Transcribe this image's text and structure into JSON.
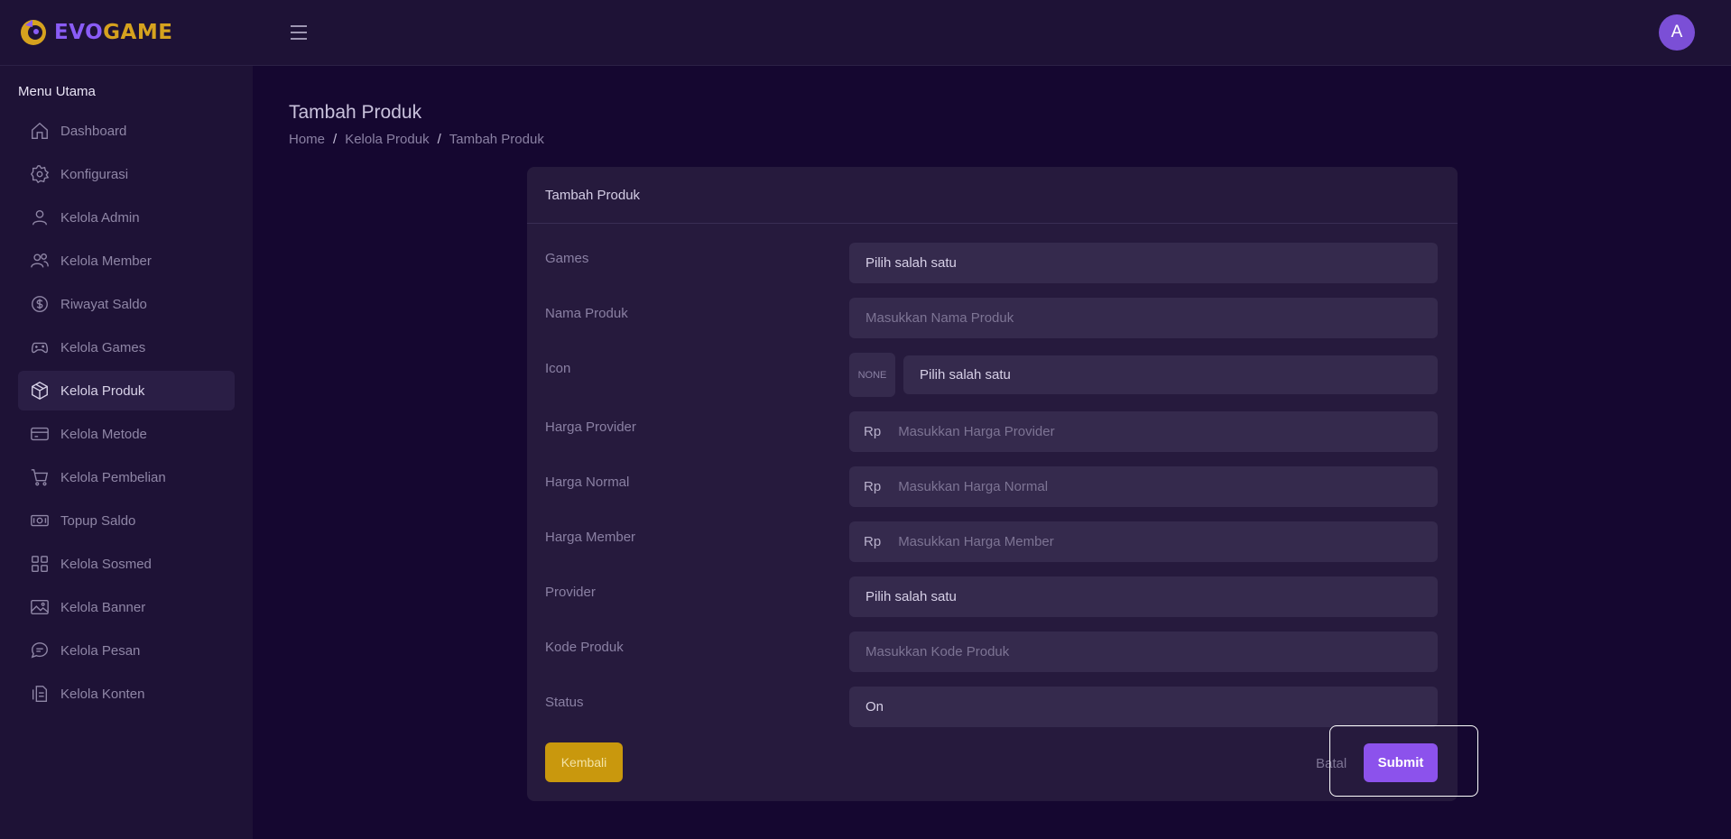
{
  "brand": {
    "part1": "EVO",
    "part2": "GAME"
  },
  "header": {
    "avatar_initial": "A"
  },
  "sidebar": {
    "heading": "Menu Utama",
    "items": [
      {
        "label": "Dashboard",
        "icon": "home-icon",
        "active": false
      },
      {
        "label": "Konfigurasi",
        "icon": "gear-icon",
        "active": false
      },
      {
        "label": "Kelola Admin",
        "icon": "user-icon",
        "active": false
      },
      {
        "label": "Kelola Member",
        "icon": "users-icon",
        "active": false
      },
      {
        "label": "Riwayat Saldo",
        "icon": "dollar-circle-icon",
        "active": false
      },
      {
        "label": "Kelola Games",
        "icon": "gamepad-icon",
        "active": false
      },
      {
        "label": "Kelola Produk",
        "icon": "box-icon",
        "active": true
      },
      {
        "label": "Kelola Metode",
        "icon": "credit-card-icon",
        "active": false
      },
      {
        "label": "Kelola Pembelian",
        "icon": "cart-icon",
        "active": false
      },
      {
        "label": "Topup Saldo",
        "icon": "cash-icon",
        "active": false
      },
      {
        "label": "Kelola Sosmed",
        "icon": "grid-icon",
        "active": false
      },
      {
        "label": "Kelola Banner",
        "icon": "image-icon",
        "active": false
      },
      {
        "label": "Kelola Pesan",
        "icon": "message-icon",
        "active": false
      },
      {
        "label": "Kelola Konten",
        "icon": "document-icon",
        "active": false
      }
    ]
  },
  "page": {
    "title": "Tambah Produk",
    "breadcrumb": [
      "Home",
      "Kelola Produk",
      "Tambah Produk"
    ]
  },
  "form": {
    "card_title": "Tambah Produk",
    "games": {
      "label": "Games",
      "value": "Pilih salah satu"
    },
    "nama_produk": {
      "label": "Nama Produk",
      "placeholder": "Masukkan Nama Produk"
    },
    "icon": {
      "label": "Icon",
      "none_label": "NONE",
      "value": "Pilih salah satu"
    },
    "harga_provider": {
      "label": "Harga Provider",
      "prefix": "Rp",
      "placeholder": "Masukkan Harga Provider"
    },
    "harga_normal": {
      "label": "Harga Normal",
      "prefix": "Rp",
      "placeholder": "Masukkan Harga Normal"
    },
    "harga_member": {
      "label": "Harga Member",
      "prefix": "Rp",
      "placeholder": "Masukkan Harga Member"
    },
    "provider": {
      "label": "Provider",
      "value": "Pilih salah satu"
    },
    "kode_produk": {
      "label": "Kode Produk",
      "placeholder": "Masukkan Kode Produk"
    },
    "status": {
      "label": "Status",
      "value": "On"
    },
    "buttons": {
      "back": "Kembali",
      "cancel": "Batal",
      "submit": "Submit"
    }
  },
  "colors": {
    "background": "#150730",
    "panel": "#1e1236",
    "card": "#261a3d",
    "input": "#352a4d",
    "accent_purple": "#8c52ec",
    "accent_gold": "#c9980d"
  }
}
